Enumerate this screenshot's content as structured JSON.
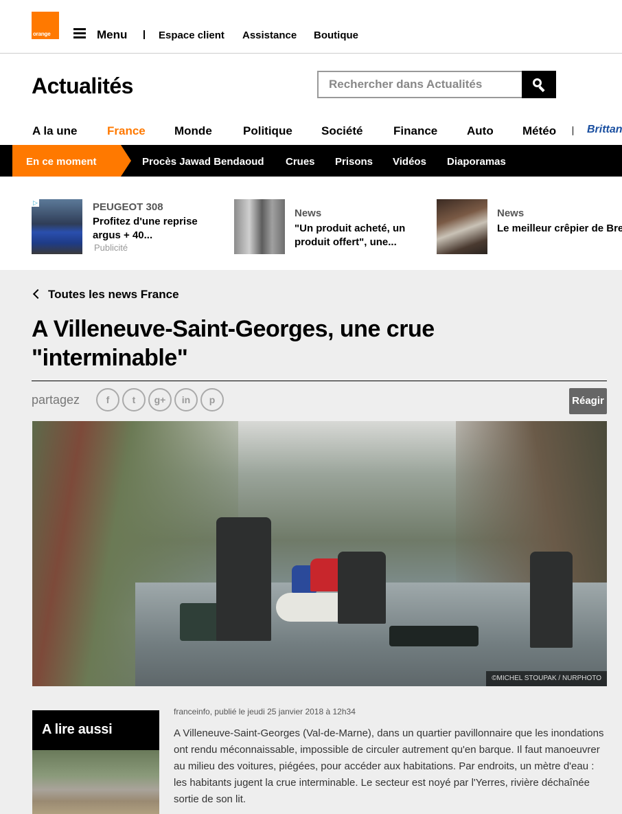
{
  "topbar": {
    "logo_text": "orange",
    "menu_label": "Menu",
    "links": [
      "Espace client",
      "Assistance",
      "Boutique"
    ]
  },
  "header": {
    "title": "Actualités",
    "search_placeholder": "Rechercher dans Actualités"
  },
  "nav": {
    "items": [
      "A la une",
      "France",
      "Monde",
      "Politique",
      "Société",
      "Finance",
      "Auto",
      "Météo"
    ],
    "active": "France",
    "partner": "Brittany"
  },
  "trending": {
    "badge": "En ce moment",
    "links": [
      "Procès Jawad Bendaoud",
      "Crues",
      "Prisons",
      "Vidéos",
      "Diaporamas"
    ]
  },
  "promos": [
    {
      "kicker": "PEUGEOT 308",
      "text": "Profitez d'une reprise argus + 40...",
      "sub": "Publicité"
    },
    {
      "kicker": "News",
      "text": "\"Un produit acheté, un produit offert\", une...",
      "sub": ""
    },
    {
      "kicker": "News",
      "text": "Le meilleur crêpier de Bretagne (et du monde)...",
      "sub": ""
    }
  ],
  "article": {
    "back_link": "Toutes les news France",
    "headline": "A Villeneuve-Saint-Georges, une crue \"interminable\"",
    "share_label": "partagez",
    "share_icons": [
      "facebook-icon",
      "twitter-icon",
      "googleplus-icon",
      "linkedin-icon",
      "pinterest-icon"
    ],
    "react_label": "Réagir",
    "photo_credit": "©MICHEL STOUPAK / NURPHOTO",
    "byline": "franceinfo, publié le jeudi 25 janvier 2018 à 12h34",
    "body": "A Villeneuve-Saint-Georges (Val-de-Marne), dans un quartier pavillonnaire que les inondations ont rendu méconnaissable, impossible de circuler autrement qu'en barque. Il faut manoeuvrer au milieu des voitures, piégées, pour accéder aux habitations. Par endroits, un mètre d'eau : les habitants jugent la crue interminable. Le secteur est noyé par l'Yerres, rivière déchaînée sortie de son lit."
  },
  "read_also": {
    "title": "A lire aussi"
  },
  "colors": {
    "brand_orange": "#ff7900",
    "trend_bar": "#000000",
    "article_bg": "#eeeeee"
  }
}
